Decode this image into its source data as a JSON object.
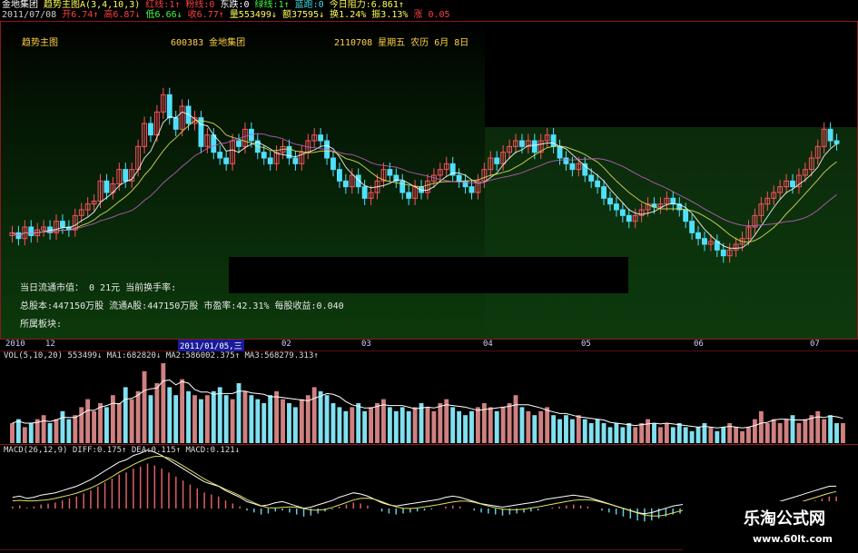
{
  "header": {
    "stock": "金地集团",
    "indicator": "趋势主图A(3,4,10,3)",
    "red_line": "红线:1↑",
    "pink_line": "粉线:0",
    "east": "东跌:0",
    "green_line": "绿线:1↑",
    "blue_line": "蓝跑:0",
    "resistance": "今日阻力:6.861↑",
    "date": "2011/07/08",
    "open": "开6.74↑",
    "high": "高6.87↓",
    "low": "低6.66↓",
    "close": "收6.77↑",
    "volume": "量553499↓",
    "amount": "额37595↓",
    "turnover": "换1.24%",
    "amplitude": "振3.13%",
    "change": "涨 0.05"
  },
  "price_panel": {
    "title": "趋势主图",
    "code_name": "600383 金地集团",
    "date_info": "2110708 星期五 农历 6月 8日",
    "info_rows": [
      "当日流通市值：  0 21元      当前换手率:",
      "总股本:447150万股  流通A股:447150万股  市盈率:42.31%  每股收益:0.040",
      "所属板块:"
    ]
  },
  "x_axis": {
    "ticks": [
      {
        "label": "2010"
      },
      {
        "label": "12"
      },
      {
        "label": "2011/01/05,三"
      },
      {
        "label": "02"
      },
      {
        "label": "03"
      },
      {
        "label": "04"
      },
      {
        "label": "05"
      },
      {
        "label": "06"
      },
      {
        "label": "07"
      }
    ]
  },
  "vol_panel": {
    "header": "VOL(5,10,20) 553499↓ MA1:682820↓ MA2:586002.375↑ MA3:568279.313↑"
  },
  "macd_panel": {
    "header": "MACD(26,12,9) DIFF:0.175↑ DEA:0.115↑ MACD:0.121↓"
  },
  "watermark": {
    "name": "乐淘公式网",
    "url": "www.60lt.com"
  },
  "colors": {
    "up": "#ff5060",
    "down": "#50e0ff",
    "ma_white": "#ffffff",
    "ma_yellow": "#e0e060",
    "frame": "#a02020",
    "bg_green": "#0a3a0a"
  },
  "chart_data": {
    "type": "candlestick",
    "ylim": [
      5.0,
      9.5
    ],
    "close_series": [
      6.4,
      6.3,
      6.5,
      6.35,
      6.45,
      6.5,
      6.4,
      6.6,
      6.5,
      6.45,
      6.7,
      6.8,
      6.9,
      6.95,
      7.3,
      7.1,
      7.25,
      7.5,
      7.3,
      7.5,
      7.9,
      8.3,
      8.1,
      8.5,
      8.8,
      8.4,
      8.2,
      8.6,
      8.3,
      8.4,
      7.9,
      8.1,
      7.8,
      7.7,
      7.6,
      8.0,
      7.9,
      8.2,
      8.0,
      7.8,
      7.7,
      7.6,
      7.8,
      7.9,
      7.7,
      7.6,
      7.8,
      8.0,
      8.1,
      8.0,
      7.7,
      7.5,
      7.3,
      7.2,
      7.4,
      7.2,
      7.0,
      7.1,
      7.3,
      7.5,
      7.4,
      7.3,
      7.1,
      7.0,
      7.2,
      7.1,
      7.3,
      7.4,
      7.5,
      7.6,
      7.4,
      7.3,
      7.2,
      7.1,
      7.3,
      7.5,
      7.7,
      7.6,
      7.8,
      7.9,
      8.0,
      7.9,
      8.0,
      7.8,
      8.0,
      8.1,
      7.9,
      7.7,
      7.6,
      7.5,
      7.6,
      7.4,
      7.3,
      7.2,
      7.0,
      6.9,
      6.8,
      6.7,
      6.6,
      6.7,
      6.8,
      6.9,
      6.85,
      6.9,
      7.0,
      6.9,
      6.8,
      6.6,
      6.4,
      6.3,
      6.2,
      6.25,
      6.1,
      6.0,
      6.1,
      6.2,
      6.3,
      6.5,
      6.7,
      6.9,
      7.0,
      7.1,
      7.2,
      7.3,
      7.2,
      7.4,
      7.5,
      7.7,
      7.9,
      8.2,
      8.0,
      7.95
    ],
    "volume_series": [
      5,
      6,
      4,
      5,
      6,
      7,
      5,
      6,
      8,
      6,
      7,
      9,
      11,
      8,
      10,
      9,
      12,
      10,
      14,
      11,
      13,
      18,
      12,
      15,
      20,
      14,
      12,
      16,
      13,
      12,
      11,
      12,
      13,
      14,
      12,
      11,
      15,
      13,
      12,
      11,
      10,
      12,
      13,
      11,
      10,
      9,
      11,
      12,
      14,
      13,
      12,
      10,
      9,
      8,
      9,
      10,
      8,
      9,
      10,
      11,
      9,
      8,
      9,
      8,
      9,
      10,
      9,
      8,
      10,
      11,
      9,
      8,
      7,
      8,
      9,
      10,
      9,
      8,
      9,
      10,
      12,
      9,
      8,
      7,
      8,
      9,
      7,
      6,
      7,
      6,
      7,
      6,
      5,
      6,
      5,
      4,
      5,
      4,
      5,
      4,
      5,
      6,
      5,
      4,
      5,
      4,
      5,
      4,
      3,
      4,
      5,
      4,
      3,
      4,
      5,
      4,
      3,
      4,
      6,
      8,
      5,
      6,
      5,
      6,
      7,
      5,
      6,
      7,
      8,
      6,
      7,
      5,
      5
    ],
    "macd_series": [
      0.02,
      0.03,
      0.01,
      0.02,
      0.04,
      0.05,
      0.06,
      0.08,
      0.1,
      0.12,
      0.15,
      0.18,
      0.22,
      0.26,
      0.3,
      0.34,
      0.36,
      0.4,
      0.42,
      0.45,
      0.43,
      0.4,
      0.36,
      0.32,
      0.28,
      0.24,
      0.2,
      0.16,
      0.14,
      0.12,
      0.08,
      0.05,
      0.02,
      -0.02,
      -0.04,
      -0.06,
      -0.05,
      -0.03,
      -0.02,
      -0.04,
      -0.06,
      -0.08,
      -0.07,
      -0.05,
      -0.03,
      -0.01,
      0.02,
      0.04,
      0.06,
      0.05,
      0.03,
      0.0,
      -0.03,
      -0.05,
      -0.06,
      -0.05,
      -0.04,
      -0.03,
      -0.02,
      -0.01,
      0.0,
      0.02,
      0.03,
      0.02,
      0.0,
      -0.02,
      -0.04,
      -0.05,
      -0.06,
      -0.07,
      -0.06,
      -0.05,
      -0.04,
      -0.03,
      -0.02,
      0.0,
      0.01,
      0.02,
      0.03,
      0.04,
      0.03,
      0.02,
      0.0,
      -0.02,
      -0.04,
      -0.06,
      -0.08,
      -0.1,
      -0.12,
      -0.13,
      -0.12,
      -0.1,
      -0.08,
      -0.06,
      -0.05,
      -0.04,
      -0.05,
      -0.06,
      -0.07,
      -0.06,
      -0.05,
      -0.04,
      -0.05,
      -0.06,
      -0.07,
      -0.08,
      -0.06,
      -0.04,
      -0.02,
      0.0,
      0.02,
      0.04,
      0.06,
      0.08,
      0.1,
      0.12,
      0.121
    ]
  }
}
